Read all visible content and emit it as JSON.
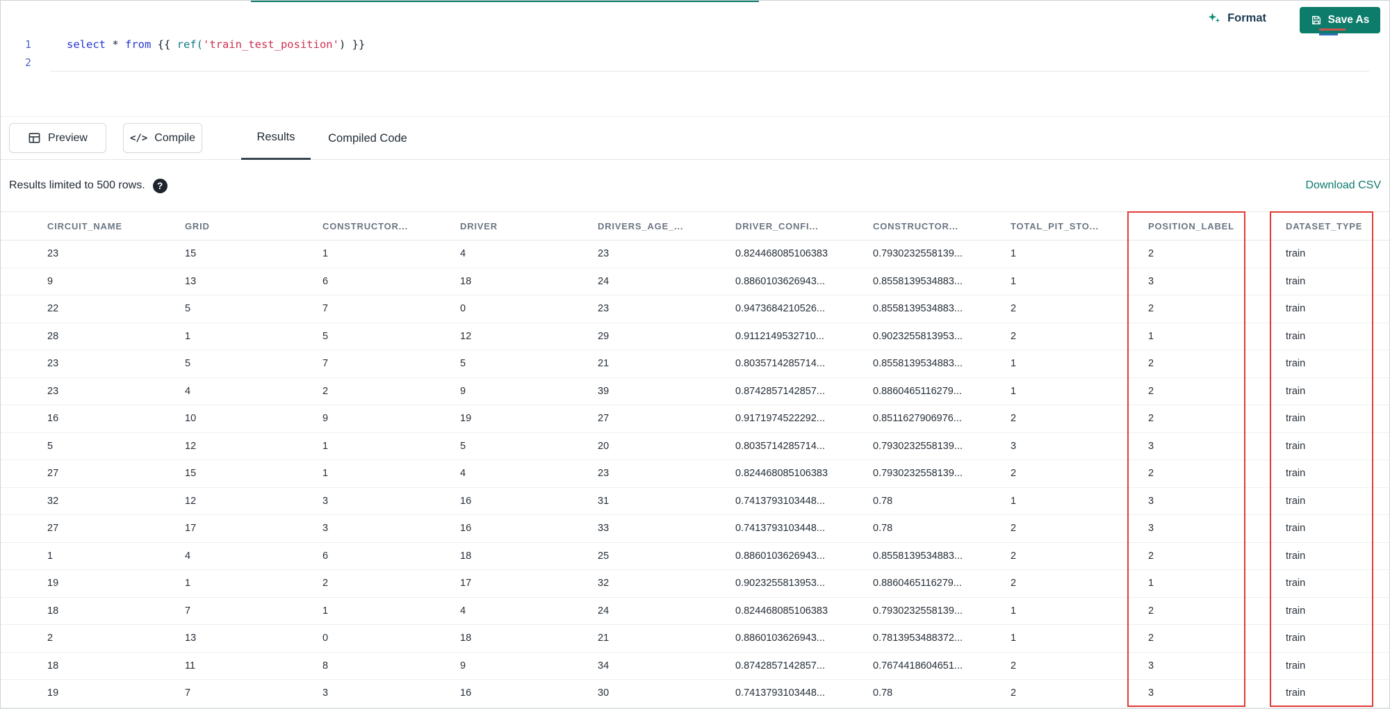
{
  "top_bar": {
    "format_label": "Format",
    "save_as_label": "Save As"
  },
  "editor": {
    "line_numbers": [
      "1",
      "2"
    ],
    "code": {
      "kw_select": "select",
      "op_star": " * ",
      "kw_from": "from",
      "punct_open": " {{ ",
      "fn_ref": "ref(",
      "str_arg": "'train_test_position'",
      "punct_paren": ")",
      "punct_close": " }}"
    }
  },
  "toolbar": {
    "preview_label": "Preview",
    "compile_label": "Compile",
    "compile_icon_glyph": "</>",
    "tabs": [
      {
        "label": "Results",
        "active": true
      },
      {
        "label": "Compiled Code",
        "active": false
      }
    ]
  },
  "results_bar": {
    "limit_text": "Results limited to 500 rows.",
    "help_glyph": "?",
    "download_label": "Download CSV"
  },
  "table": {
    "columns": [
      "CIRCUIT_NAME",
      "GRID",
      "CONSTRUCTOR...",
      "DRIVER",
      "DRIVERS_AGE_...",
      "DRIVER_CONFI...",
      "CONSTRUCTOR...",
      "TOTAL_PIT_STO...",
      "POSITION_LABEL",
      "DATASET_TYPE"
    ],
    "rows": [
      [
        "23",
        "15",
        "1",
        "4",
        "23",
        "0.824468085106383",
        "0.7930232558139...",
        "1",
        "2",
        "train"
      ],
      [
        "9",
        "13",
        "6",
        "18",
        "24",
        "0.8860103626943...",
        "0.8558139534883...",
        "1",
        "3",
        "train"
      ],
      [
        "22",
        "5",
        "7",
        "0",
        "23",
        "0.9473684210526...",
        "0.8558139534883...",
        "2",
        "2",
        "train"
      ],
      [
        "28",
        "1",
        "5",
        "12",
        "29",
        "0.9112149532710...",
        "0.9023255813953...",
        "2",
        "1",
        "train"
      ],
      [
        "23",
        "5",
        "7",
        "5",
        "21",
        "0.8035714285714...",
        "0.8558139534883...",
        "1",
        "2",
        "train"
      ],
      [
        "23",
        "4",
        "2",
        "9",
        "39",
        "0.8742857142857...",
        "0.8860465116279...",
        "1",
        "2",
        "train"
      ],
      [
        "16",
        "10",
        "9",
        "19",
        "27",
        "0.9171974522292...",
        "0.8511627906976...",
        "2",
        "2",
        "train"
      ],
      [
        "5",
        "12",
        "1",
        "5",
        "20",
        "0.8035714285714...",
        "0.7930232558139...",
        "3",
        "3",
        "train"
      ],
      [
        "27",
        "15",
        "1",
        "4",
        "23",
        "0.824468085106383",
        "0.7930232558139...",
        "2",
        "2",
        "train"
      ],
      [
        "32",
        "12",
        "3",
        "16",
        "31",
        "0.7413793103448...",
        "0.78",
        "1",
        "3",
        "train"
      ],
      [
        "27",
        "17",
        "3",
        "16",
        "33",
        "0.7413793103448...",
        "0.78",
        "2",
        "3",
        "train"
      ],
      [
        "1",
        "4",
        "6",
        "18",
        "25",
        "0.8860103626943...",
        "0.8558139534883...",
        "2",
        "2",
        "train"
      ],
      [
        "19",
        "1",
        "2",
        "17",
        "32",
        "0.9023255813953...",
        "0.8860465116279...",
        "2",
        "1",
        "train"
      ],
      [
        "18",
        "7",
        "1",
        "4",
        "24",
        "0.824468085106383",
        "0.7930232558139...",
        "1",
        "2",
        "train"
      ],
      [
        "2",
        "13",
        "0",
        "18",
        "21",
        "0.8860103626943...",
        "0.7813953488372...",
        "1",
        "2",
        "train"
      ],
      [
        "18",
        "11",
        "8",
        "9",
        "34",
        "0.8742857142857...",
        "0.7674418604651...",
        "2",
        "3",
        "train"
      ],
      [
        "19",
        "7",
        "3",
        "16",
        "30",
        "0.7413793103448...",
        "0.78",
        "2",
        "3",
        "train"
      ]
    ],
    "highlighted_columns": [
      "POSITION_LABEL",
      "DATASET_TYPE"
    ]
  },
  "icons": {
    "format": "sparkles-icon",
    "save_as": "floppy-disk-icon",
    "preview": "table-grid-icon",
    "compile": "code-brackets-icon",
    "help": "question-circle-icon"
  },
  "colors": {
    "accent_teal": "#0e7c6b",
    "highlight_red": "#e23a34",
    "keyword_blue": "#2436d4",
    "string_red": "#cf3050",
    "tab_underline": "#39454f"
  }
}
